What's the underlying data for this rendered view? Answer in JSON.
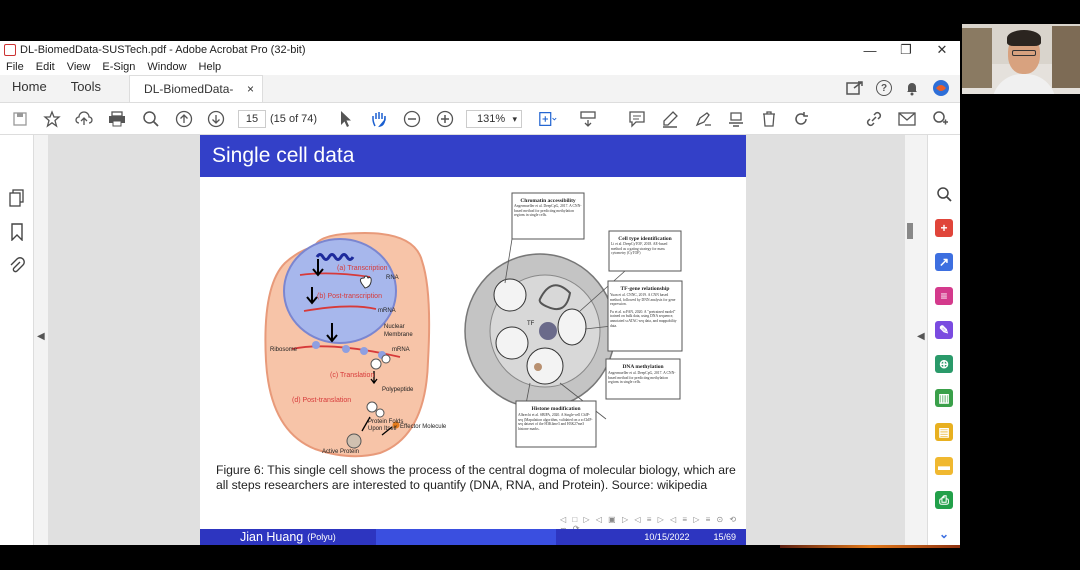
{
  "window": {
    "title": "DL-BiomedData-SUSTech.pdf - Adobe Acrobat Pro (32-bit)",
    "minimize": "—",
    "maximize": "❐",
    "close": "✕"
  },
  "menu": [
    "File",
    "Edit",
    "View",
    "E-Sign",
    "Window",
    "Help"
  ],
  "tabs": {
    "home": "Home",
    "tools": "Tools",
    "document": "DL-BiomedData-SU...",
    "document_close": "×"
  },
  "toolbar": {
    "page_value": "15",
    "page_count": "(15 of 74)",
    "zoom": "131%"
  },
  "slide": {
    "title": "Single cell data",
    "caption": "Figure 6: This single cell shows the process of the central dogma of molecular biology, which are all steps researchers are interested to quantify (DNA, RNA, and Protein). Source: wikipedia",
    "presenter": "Jian Huang",
    "institution": "(Polyu)",
    "date": "10/15/2022",
    "page": "15/69",
    "nav": "◁ □ ▷ ◁ ▣ ▷ ◁ ≡ ▷ ◁ ≡ ▷ ≡ ⊙ ⟲ ∽ ⟳"
  },
  "figure_left": {
    "labels": {
      "transcription": "(a) Transcription",
      "rna": "RNA",
      "post_transcription": "(b) Post-transcription",
      "mrna_top": "mRNA",
      "nuclear_membrane_1": "Nuclear",
      "nuclear_membrane_2": "Membrane",
      "ribosome": "Ribosome",
      "mrna_mid": "mRNA",
      "translation": "(c) Translation",
      "polypeptide": "Polypeptide",
      "post_translation": "(d) Post-translation",
      "protein_folds_1": "Protein Folds",
      "protein_folds_2": "Upon Itself",
      "effector": "Effector Molecule",
      "active_protein": "Active Protein"
    }
  },
  "figure_right": {
    "chromatin_title": "Chromatin accessibility",
    "chromatin_text": "Angermueller et al. DeepCpG, 2017. A CNN-based method for predicting methylation regions in single cells.",
    "celltype_title": "Cell type identification",
    "celltype_text": "Li et al. DeepCyTOF, 2018. AE-based method as a gating strategy for mass cytometry (CyTOF)",
    "tf_title": "TF-gene relationship",
    "tf_text_1": "Yuan et al. CNNC, 2019. A CNN based method, followed by DNN analysis for gene expression.",
    "tf_text_2": "Fu et al. scFAN, 2020. A \"pretrained model\" trained on bulk data, using DNA sequence, annotated scATAC-seq data, and mappability data.",
    "dna_title": "DNA methylation",
    "dna_text": "Angermueller et al. DeepCpG, 2017. A CNN-based method for predicting methylation regions in single cells.",
    "histone_title": "Histone modification",
    "histone_text": "Albrecht et al. SBIPA, 2020. A Single-cell ChIP-seq (Mapulation algorithm, validated on a scChIP-seq dataset of the H3K4me3 and H3K27me3 histone marks.",
    "tf_label": "TF"
  }
}
